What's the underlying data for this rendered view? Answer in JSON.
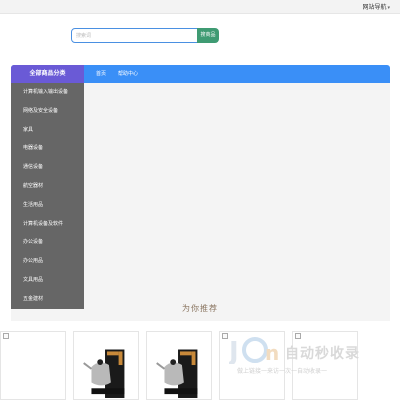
{
  "topbar": {
    "site_nav": "网站导航"
  },
  "search": {
    "placeholder": "搜索词",
    "button": "搜商品"
  },
  "nav": {
    "all_categories": "全部商品分类",
    "links": [
      "首页",
      "帮助中心"
    ]
  },
  "sidebar": {
    "items": [
      "计算机输入输出设备",
      "网络及安全设备",
      "家具",
      "电器设备",
      "通信设备",
      "航空器材",
      "生活用品",
      "计算机设备及软件",
      "办公设备",
      "办公用品",
      "文具用品",
      "五金建材"
    ]
  },
  "section": {
    "title": "为你推荐"
  },
  "watermark": {
    "brand": "自动秒收录",
    "sub": "做上链接一来访一次一自动收录一"
  },
  "colors": {
    "accent": "#3a8ff7",
    "category_header": "#6a5ad6",
    "search_button": "#3f9b73",
    "sidebar": "#666666"
  }
}
